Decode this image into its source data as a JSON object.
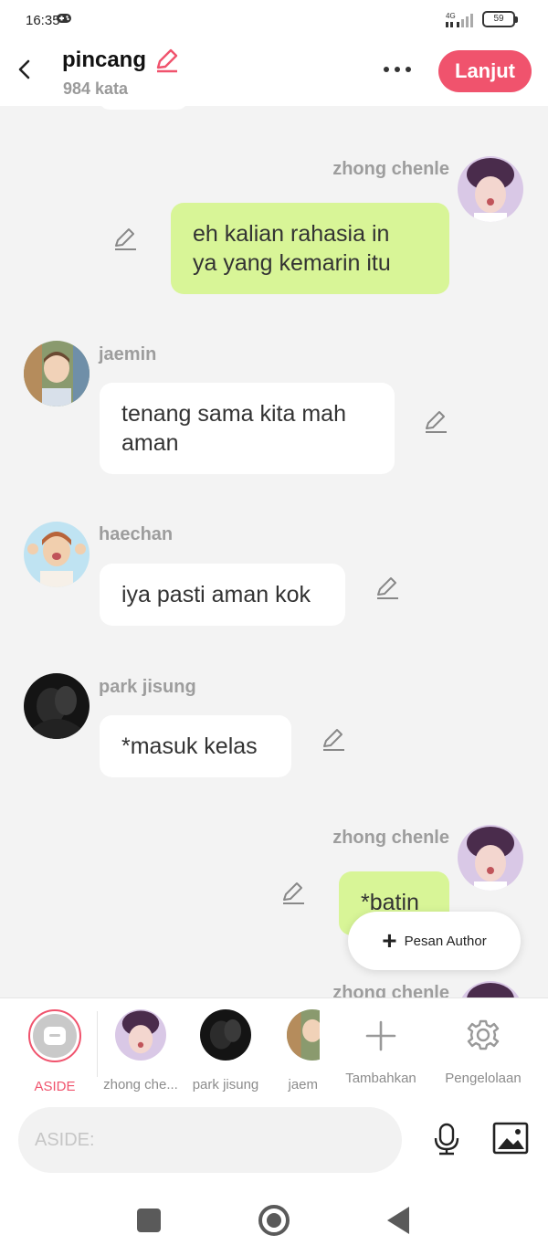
{
  "status": {
    "time": "16:35",
    "network": "4G",
    "battery": "59"
  },
  "header": {
    "title": "pincang",
    "word_count": "984 kata",
    "next_label": "Lanjut"
  },
  "messages": [
    {
      "sender": "zhong chenle",
      "side": "right",
      "text_lines": [
        "eh kalian rahasia in",
        "ya yang kemarin itu"
      ]
    },
    {
      "sender": "jaemin",
      "side": "left",
      "text_lines": [
        "tenang sama kita mah",
        "aman"
      ]
    },
    {
      "sender": "haechan",
      "side": "left",
      "text_lines": [
        "iya pasti aman kok"
      ]
    },
    {
      "sender": "park jisung",
      "side": "left",
      "text_lines": [
        "*masuk kelas"
      ]
    },
    {
      "sender": "zhong chenle",
      "side": "right",
      "text_lines": [
        "*batin"
      ]
    },
    {
      "sender": "zhong chenle",
      "side": "right",
      "text_lines": []
    }
  ],
  "pesan_author_label": "Pesan Author",
  "characters": [
    {
      "label": "ASIDE"
    },
    {
      "label": "zhong che..."
    },
    {
      "label": "park jisung"
    },
    {
      "label": "jaem"
    }
  ],
  "actions": {
    "add_label": "Tambahkan",
    "manage_label": "Pengelolaan"
  },
  "input": {
    "placeholder": "ASIDE:"
  },
  "colors": {
    "accent": "#f0536d",
    "green_bubble": "#d8f597",
    "background": "#f3f3f3"
  }
}
